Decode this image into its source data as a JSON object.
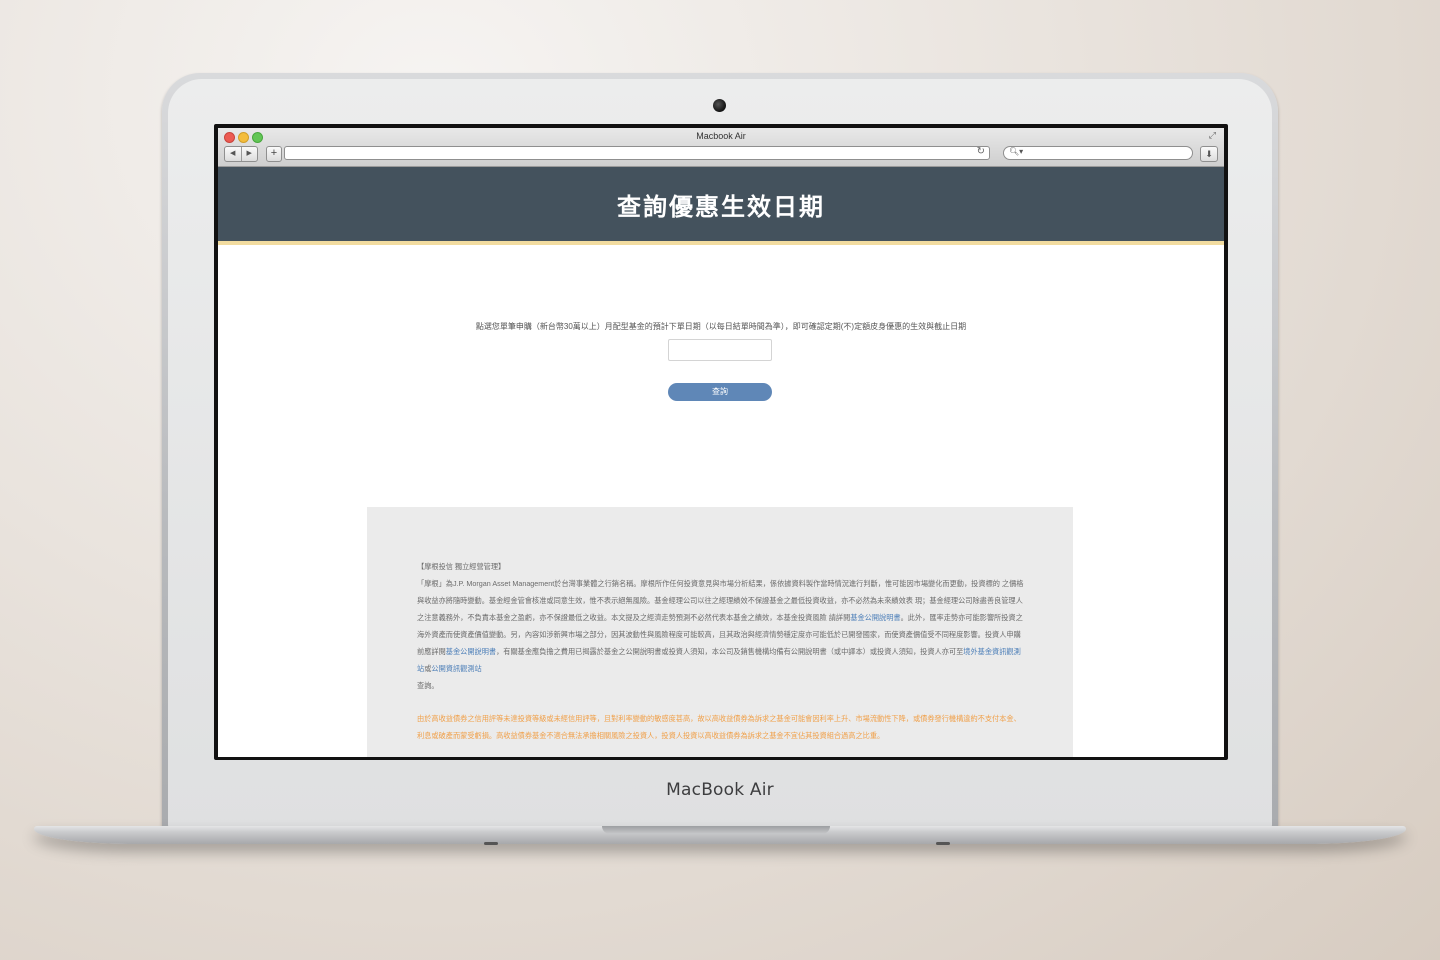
{
  "device": {
    "brand": "MacBook Air"
  },
  "browser": {
    "window_title": "Macbook Air",
    "url": "",
    "search_placeholder": "",
    "icons": {
      "back": "back-arrow-icon",
      "forward": "forward-arrow-icon",
      "add_tab": "plus-icon",
      "reload": "reload-icon",
      "search": "search-icon",
      "download": "download-icon",
      "expand": "expand-icon"
    }
  },
  "page": {
    "header_color": "#44525d",
    "accent_color": "#f2dca0",
    "button_color": "#5f87b7",
    "title": "查詢優惠生效日期",
    "instruction": "點選您單筆申購（新台幣30萬以上）月配型基金的預計下單日期（以每日結單時間為準），即可確認定期(不)定額皮身優惠的生效與截止日期",
    "date_input_value": "",
    "query_button_label": "查詢"
  },
  "disclaimer": {
    "heading": "【摩根投信 獨立經營管理】",
    "body_1": "「摩根」為J.P. Morgan Asset Management於台灣事業體之行銷名稱。摩根所作任何投資意見與市場分析結果，係依據資料製作當時情況進行判斷，惟可能因市場變化而更動，投資標的 之價格與收益亦將隨時變動。基金經金管會核准或同意生效，惟不表示絕無風險。基金經理公司以往之經理績效不保證基金之最低投資收益，亦不必然為未來績效表 現；基金經理公司除盡善良管理人之注意義務外，不負責本基金之盈虧，亦不保證最低之收益。本文提及之經濟走勢預測不必然代表本基金之績效，本基金投資風險 請詳閱",
    "link_1": "基金公開說明書",
    "body_2": "。此外，匯率走勢亦可能影響所投資之海外資產而使資產價值變動。另，內容如涉新興市場之部分，因其波動性與風險程度可能較高，且其政治與經濟情勢穩定度亦可能低於已開發國家，而使資產價值受不同程度影響。投資人申購前應詳閱",
    "link_2": "基金公開說明書",
    "body_3": "，有關基金應負擔之費用已揭露於基金之公開說明書或投資人須知，本公司及銷售機構均備有公開說明書（或中譯本）或投資人須知，投資人亦可至",
    "link_3": "境外基金資訊觀測站",
    "body_4": "或",
    "link_4": "公開資訊觀測站",
    "body_5": "查詢。",
    "warning": "由於高收益債券之信用評等未達投資等級或未經信用評等，且對利率變動的敏感度甚高，故以高收益債券為訴求之基金可能會因利率上升、市場流動性下降，或債券發行機構違約不支付本金、利息或破產而蒙受虧損。高收益債券基金不適合無法承擔相關風險之投資人，投資人投資以高收益債券為訴求之基金不宜佔其投資組合過高之比重。"
  }
}
